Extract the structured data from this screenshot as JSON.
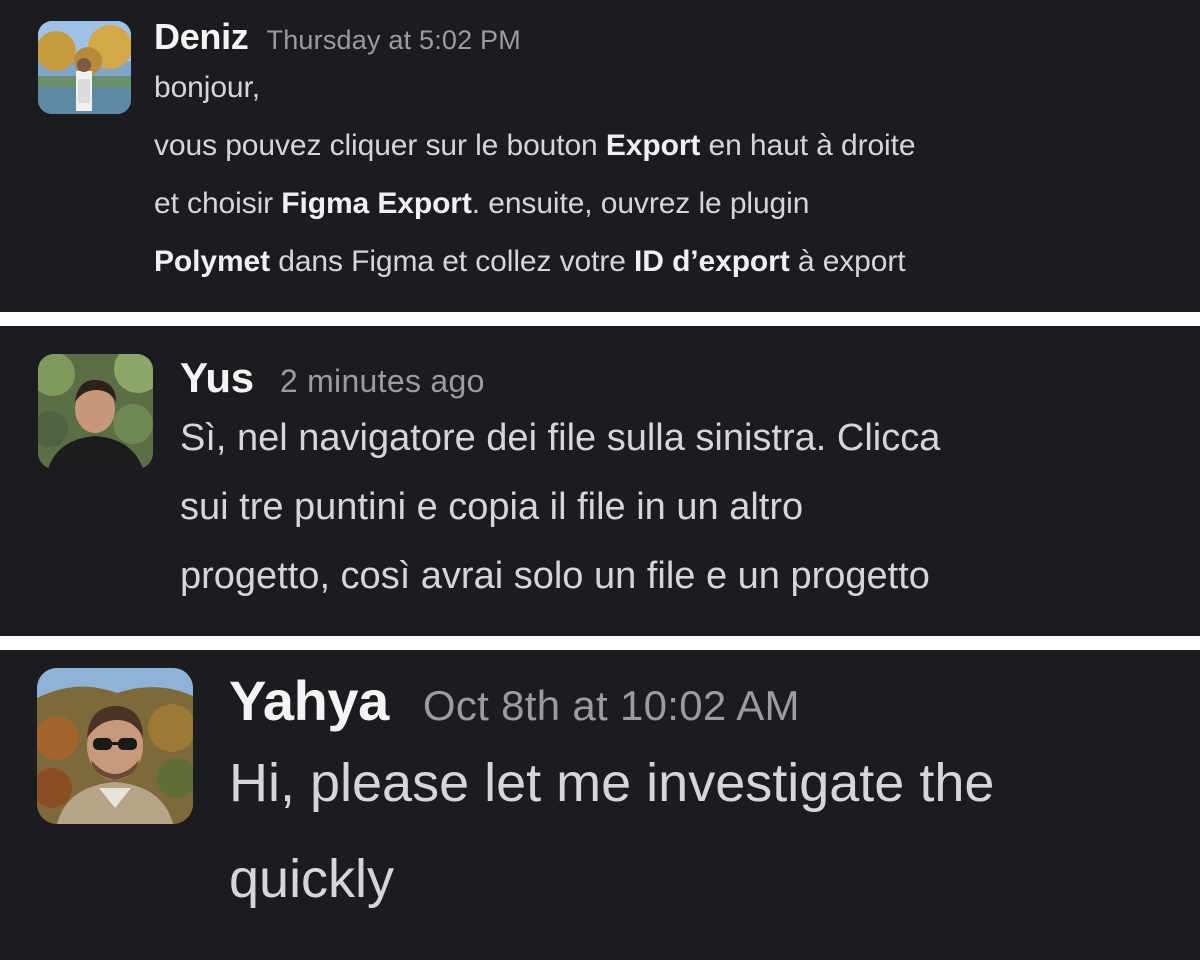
{
  "messages": [
    {
      "author": "Deniz",
      "time": "Thursday at 5:02 PM",
      "avatar_icon": "avatar-photo-deniz",
      "lines": {
        "l1": "bonjour,",
        "l2_a": "vous pouvez cliquer sur le bouton ",
        "l2_b": "Export",
        "l2_c": " en haut à droite",
        "l3_a": "et choisir ",
        "l3_b": "Figma Export",
        "l3_c": ". ensuite, ouvrez le plugin",
        "l4_a": "Polymet",
        "l4_b": " dans Figma et collez votre ",
        "l4_c": "ID d’export",
        "l4_d": " à export"
      }
    },
    {
      "author": "Yus",
      "time": "2 minutes ago",
      "avatar_icon": "avatar-photo-yus",
      "lines": {
        "l1": "Sì, nel navigatore dei file sulla sinistra. Clicca",
        "l2": "sui tre puntini e copia il file in un altro",
        "l3": "progetto, così avrai solo un file e un progetto"
      }
    },
    {
      "author": "Yahya",
      "time": "Oct 8th at 10:02 AM",
      "avatar_icon": "avatar-photo-yahya",
      "lines": {
        "l1": "Hi, please let me investigate the",
        "l2": "quickly"
      }
    }
  ],
  "colors": {
    "panel_bg": "#1b1c1f",
    "separator": "#ffffff",
    "author": "#f4f4f5",
    "timestamp": "#9b9ca0",
    "body_text": "#d6d6d8"
  }
}
